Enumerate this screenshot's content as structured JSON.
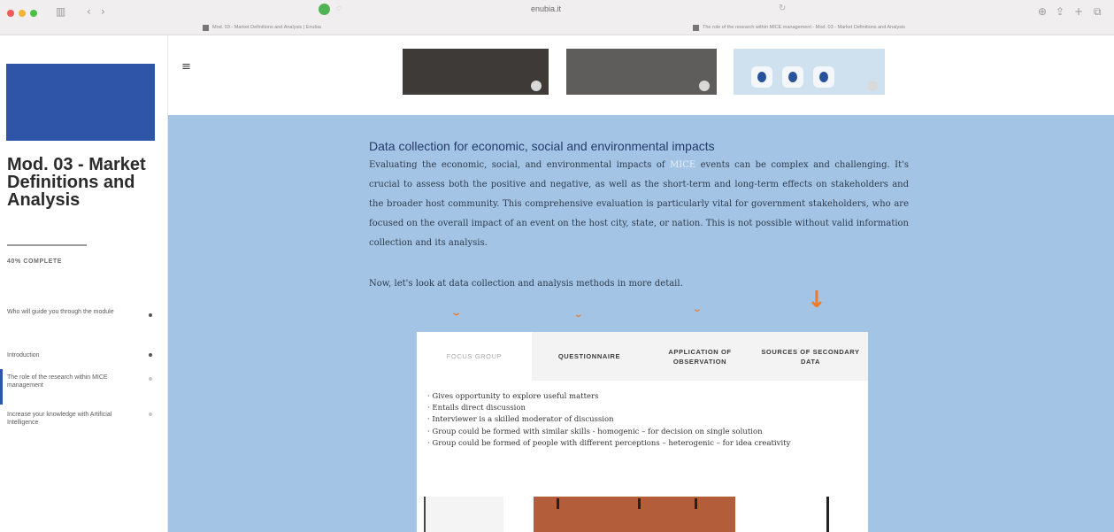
{
  "browser": {
    "url": "enubia.it",
    "tabs": [
      {
        "label": "Mod. 03 - Market Definitions and Analysis | Enubia"
      },
      {
        "label": "The role of the research within MICE management - Mod. 03 - Market Definitions and Analysis"
      }
    ]
  },
  "sidebar": {
    "course_title": "Mod. 03 - Market Definitions and Analysis",
    "progress_label": "40% COMPLETE",
    "items": [
      {
        "label": "Who will guide you through the module"
      },
      {
        "label": "Introduction"
      },
      {
        "label": "The role of the research within MICE management"
      },
      {
        "label": "Increase your knowledge with Artificial Intelligence"
      }
    ]
  },
  "main": {
    "heading": "Data collection for economic, social and environmental impacts",
    "paragraph_before": "Evaluating the economic, social, and environmental impacts of",
    "highlight": "MICE",
    "paragraph_after": "events can be complex and challenging. It's crucial to assess both the positive and negative, as well as the short-term and long-term effects on stakeholders and the broader host community. This comprehensive evaluation is particularly vital for government stakeholders, who are focused on the overall impact of an event on the host city, state, or nation. This is not possible without valid information collection and its analysis.",
    "prompt": "Now, let's look at data collection and analysis methods in more detail.",
    "tabs": [
      {
        "label": "FOCUS GROUP"
      },
      {
        "label": "QUESTIONNAIRE"
      },
      {
        "label": "APPLICATION OF OBSERVATION"
      },
      {
        "label": "SOURCES OF SECONDARY DATA"
      }
    ],
    "focus_group_points": [
      "· Gives opportunity to explore useful matters",
      "· Entails direct discussion",
      "· Interviewer is a skilled moderator of discussion",
      "· Group could be formed with similar skills - homogenic – for decision on single solution",
      "· Group could be formed of people with different perceptions – heterogenic – for idea creativity"
    ]
  },
  "colors": {
    "accent_blue": "#2e55a8",
    "content_bg": "#a3c4e5",
    "annotation_orange": "#f07a25"
  }
}
